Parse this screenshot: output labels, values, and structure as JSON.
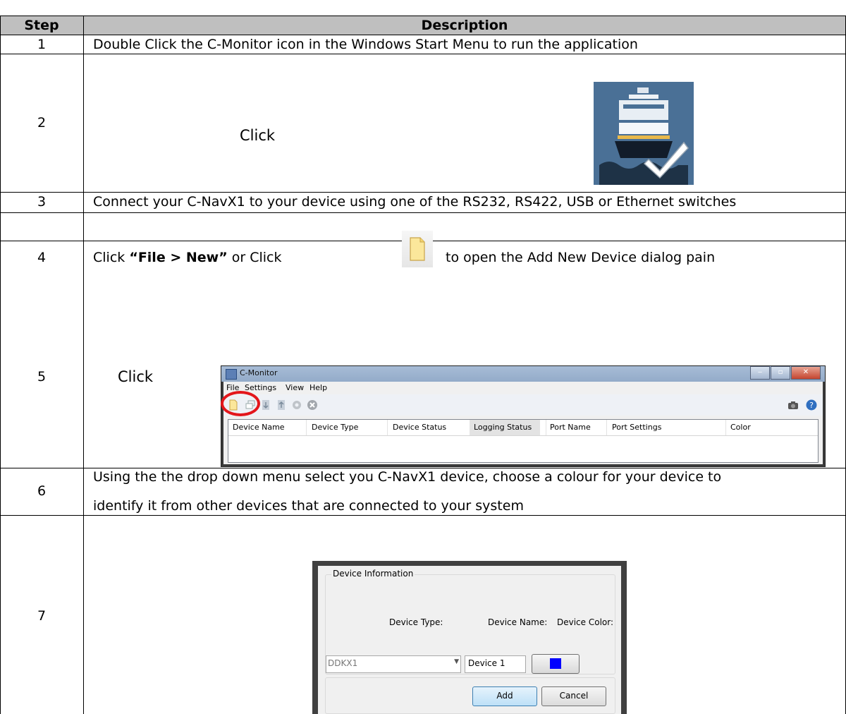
{
  "table": {
    "headers": {
      "step": "Step",
      "description": "Description"
    },
    "rows": [
      {
        "step": "1",
        "description": "Double Click the C-Monitor icon in the Windows Start Menu to run the application"
      },
      {
        "step": "2",
        "description": "Click"
      },
      {
        "step": "3",
        "description": "Connect your C-NavX1 to your device using one of the RS232, RS422, USB or Ethernet switches"
      },
      {
        "step": "4",
        "description_pre": "Click ",
        "description_bold": "“File > New”",
        "description_mid": " or Click",
        "description_post": "to open the Add New Device dialog pain"
      },
      {
        "step": "5",
        "description": "Click"
      },
      {
        "step": "6",
        "description_line1": "Using the the drop down menu select you C-NavX1 device, choose a colour for your device to",
        "description_line2": "identify it from other devices that are connected to your system"
      },
      {
        "step": "7"
      }
    ]
  },
  "cmonitor": {
    "title": "C-Monitor",
    "menu": [
      "File",
      "Settings",
      "View",
      "Help"
    ],
    "columns": [
      "Device Name",
      "Device Type",
      "Device Status",
      "Logging Status",
      "Port Name",
      "Port Settings",
      "Color"
    ]
  },
  "dialog": {
    "group_title": "Device Information",
    "device_type_label": "Device Type:",
    "device_name_label": "Device Name:",
    "device_color_label": "Device Color:",
    "device_type_value": "DDKX1",
    "device_name_value": "Device 1",
    "device_color": "#0000ff",
    "add_label": "Add",
    "cancel_label": "Cancel"
  },
  "colors": {
    "header_bg": "#bfbfbf",
    "app_icon_bg": "#4a7096",
    "highlight_circle": "#e3161b"
  }
}
